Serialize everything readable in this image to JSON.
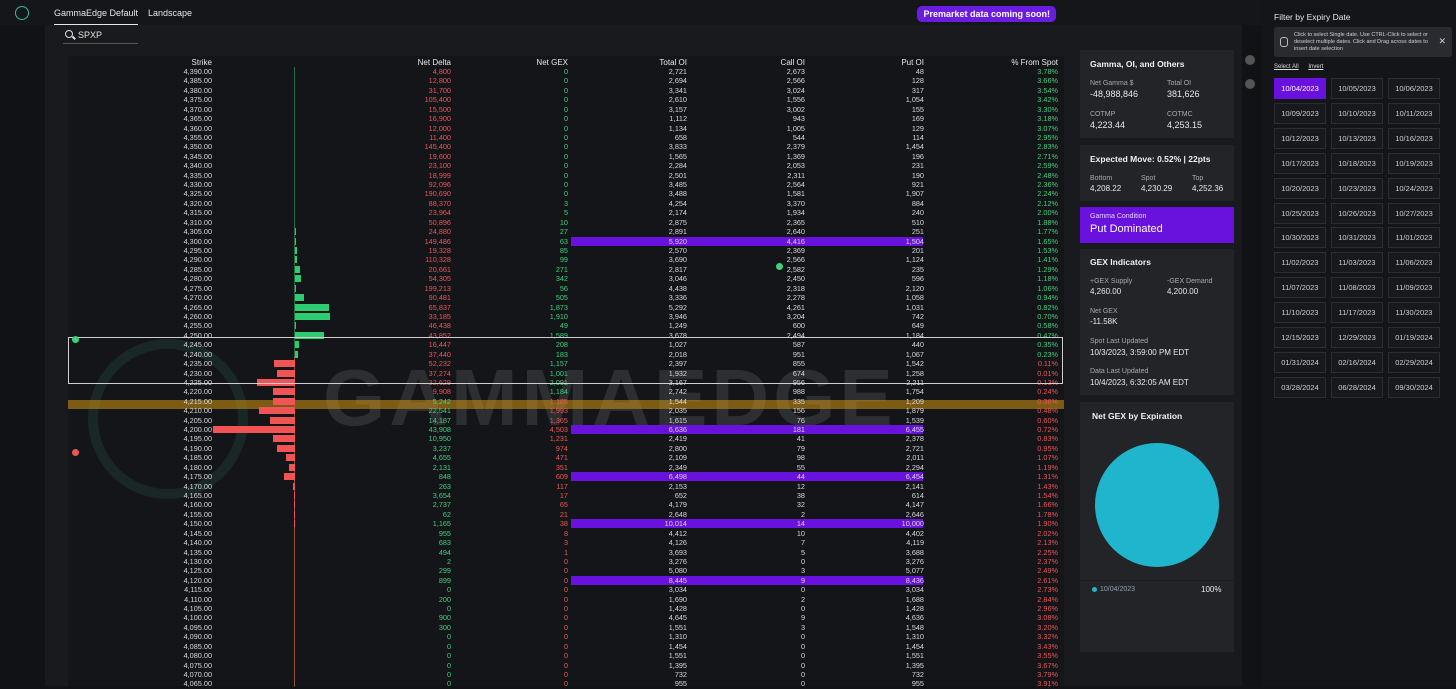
{
  "tabs": [
    "GammaEdge Default",
    "Landscape"
  ],
  "banner": "Premarket data coming soon!",
  "search": {
    "value": "SPXP"
  },
  "columns": [
    "Strike",
    "Net Delta",
    "Net GEX",
    "Total OI",
    "Call OI",
    "Put OI",
    "% From Spot"
  ],
  "rows": [
    [
      "4,390.00",
      "4,800",
      "0",
      "2,721",
      "2,673",
      "48",
      "3.78%"
    ],
    [
      "4,385.00",
      "12,800",
      "0",
      "2,694",
      "2,566",
      "128",
      "3.66%"
    ],
    [
      "4,380.00",
      "31,700",
      "0",
      "3,341",
      "3,024",
      "317",
      "3.54%"
    ],
    [
      "4,375.00",
      "105,400",
      "0",
      "2,610",
      "1,556",
      "1,054",
      "3.42%"
    ],
    [
      "4,370.00",
      "15,500",
      "0",
      "3,157",
      "3,002",
      "155",
      "3.30%"
    ],
    [
      "4,365.00",
      "16,900",
      "0",
      "1,112",
      "943",
      "169",
      "3.18%"
    ],
    [
      "4,360.00",
      "12,000",
      "0",
      "1,134",
      "1,005",
      "129",
      "3.07%"
    ],
    [
      "4,355.00",
      "11,400",
      "0",
      "658",
      "544",
      "114",
      "2.95%"
    ],
    [
      "4,350.00",
      "145,400",
      "0",
      "3,833",
      "2,379",
      "1,454",
      "2.83%"
    ],
    [
      "4,345.00",
      "19,600",
      "0",
      "1,565",
      "1,369",
      "196",
      "2.71%"
    ],
    [
      "4,340.00",
      "23,100",
      "0",
      "2,284",
      "2,053",
      "231",
      "2.59%"
    ],
    [
      "4,335.00",
      "18,999",
      "0",
      "2,501",
      "2,311",
      "190",
      "2.48%"
    ],
    [
      "4,330.00",
      "92,096",
      "0",
      "3,485",
      "2,564",
      "921",
      "2.36%"
    ],
    [
      "4,325.00",
      "190,690",
      "0",
      "3,488",
      "1,581",
      "1,907",
      "2.24%"
    ],
    [
      "4,320.00",
      "88,370",
      "3",
      "4,254",
      "3,370",
      "884",
      "2.12%"
    ],
    [
      "4,315.00",
      "23,964",
      "5",
      "2,174",
      "1,934",
      "240",
      "2.00%"
    ],
    [
      "4,310.00",
      "50,896",
      "10",
      "2,875",
      "2,365",
      "510",
      "1.88%"
    ],
    [
      "4,305.00",
      "24,880",
      "27",
      "2,891",
      "2,640",
      "251",
      "1.77%"
    ],
    [
      "4,300.00",
      "149,486",
      "63",
      "5,920",
      "4,416",
      "1,504",
      "1.65%"
    ],
    [
      "4,295.00",
      "19,328",
      "85",
      "2,570",
      "2,369",
      "201",
      "1.53%"
    ],
    [
      "4,290.00",
      "110,328",
      "99",
      "3,690",
      "2,566",
      "1,124",
      "1.41%"
    ],
    [
      "4,285.00",
      "20,661",
      "271",
      "2,817",
      "2,582",
      "235",
      "1.29%"
    ],
    [
      "4,280.00",
      "54,305",
      "342",
      "3,046",
      "2,450",
      "596",
      "1.18%"
    ],
    [
      "4,275.00",
      "199,213",
      "56",
      "4,438",
      "2,318",
      "2,120",
      "1.06%"
    ],
    [
      "4,270.00",
      "90,481",
      "505",
      "3,336",
      "2,278",
      "1,058",
      "0.94%"
    ],
    [
      "4,265.00",
      "65,837",
      "1,873",
      "5,292",
      "4,261",
      "1,031",
      "0.82%"
    ],
    [
      "4,260.00",
      "33,185",
      "1,910",
      "3,946",
      "3,204",
      "742",
      "0.70%"
    ],
    [
      "4,255.00",
      "46,438",
      "49",
      "1,249",
      "600",
      "649",
      "0.58%"
    ],
    [
      "4,250.00",
      "43,852",
      "1,589",
      "3,678",
      "2,494",
      "1,184",
      "0.47%"
    ],
    [
      "4,245.00",
      "16,447",
      "208",
      "1,027",
      "587",
      "440",
      "0.35%"
    ],
    [
      "4,240.00",
      "37,440",
      "183",
      "2,018",
      "951",
      "1,067",
      "0.23%"
    ],
    [
      "4,235.00",
      "52,232",
      "1,157",
      "2,397",
      "855",
      "1,542",
      "0.11%"
    ],
    [
      "4,230.00",
      "37,274",
      "1,001",
      "1,932",
      "674",
      "1,258",
      "0.01%"
    ],
    [
      "4,225.00",
      "32,629",
      "2,091",
      "3,167",
      "956",
      "2,211",
      "0.13%"
    ],
    [
      "4,220.00",
      "9,908",
      "1,184",
      "2,742",
      "988",
      "1,754",
      "0.24%"
    ],
    [
      "4,215.00",
      "5,242",
      "1,185",
      "1,544",
      "335",
      "1,209",
      "0.36%"
    ],
    [
      "4,210.00",
      "22,541",
      "1,993",
      "2,035",
      "156",
      "1,879",
      "0.48%"
    ],
    [
      "4,205.00",
      "14,187",
      "1,365",
      "1,615",
      "76",
      "1,539",
      "0.60%"
    ],
    [
      "4,200.00",
      "43,908",
      "4,503",
      "6,636",
      "181",
      "6,455",
      "0.72%"
    ],
    [
      "4,195.00",
      "10,950",
      "1,231",
      "2,419",
      "41",
      "2,378",
      "0.83%"
    ],
    [
      "4,190.00",
      "3,237",
      "974",
      "2,800",
      "79",
      "2,721",
      "0.95%"
    ],
    [
      "4,185.00",
      "4,655",
      "471",
      "2,109",
      "98",
      "2,011",
      "1.07%"
    ],
    [
      "4,180.00",
      "2,131",
      "351",
      "2,349",
      "55",
      "2,294",
      "1.19%"
    ],
    [
      "4,175.00",
      "848",
      "609",
      "6,498",
      "44",
      "6,454",
      "1.31%"
    ],
    [
      "4,170.00",
      "263",
      "117",
      "2,153",
      "12",
      "2,141",
      "1.43%"
    ],
    [
      "4,165.00",
      "3,654",
      "17",
      "652",
      "38",
      "614",
      "1.54%"
    ],
    [
      "4,160.00",
      "2,737",
      "65",
      "4,179",
      "32",
      "4,147",
      "1.66%"
    ],
    [
      "4,155.00",
      "62",
      "21",
      "2,648",
      "2",
      "2,646",
      "1.78%"
    ],
    [
      "4,150.00",
      "1,165",
      "38",
      "10,014",
      "14",
      "10,000",
      "1.90%"
    ],
    [
      "4,145.00",
      "955",
      "8",
      "4,412",
      "10",
      "4,402",
      "2.02%"
    ],
    [
      "4,140.00",
      "683",
      "3",
      "4,126",
      "7",
      "4,119",
      "2.13%"
    ],
    [
      "4,135.00",
      "494",
      "1",
      "3,693",
      "5",
      "3,688",
      "2.25%"
    ],
    [
      "4,130.00",
      "2",
      "0",
      "3,276",
      "0",
      "3,276",
      "2.37%"
    ],
    [
      "4,125.00",
      "299",
      "0",
      "5,080",
      "3",
      "5,077",
      "2.49%"
    ],
    [
      "4,120.00",
      "899",
      "0",
      "8,445",
      "9",
      "8,436",
      "2.61%"
    ],
    [
      "4,115.00",
      "0",
      "0",
      "3,034",
      "0",
      "3,034",
      "2.73%"
    ],
    [
      "4,110.00",
      "200",
      "0",
      "1,690",
      "2",
      "1,688",
      "2.84%"
    ],
    [
      "4,105.00",
      "0",
      "0",
      "1,428",
      "0",
      "1,428",
      "2.96%"
    ],
    [
      "4,100.00",
      "900",
      "0",
      "4,645",
      "9",
      "4,636",
      "3.08%"
    ],
    [
      "4,095.00",
      "300",
      "0",
      "1,551",
      "3",
      "1,548",
      "3.20%"
    ],
    [
      "4,090.00",
      "0",
      "0",
      "1,310",
      "0",
      "1,310",
      "3.32%"
    ],
    [
      "4,085.00",
      "0",
      "0",
      "1,454",
      "0",
      "1,454",
      "3.43%"
    ],
    [
      "4,080.00",
      "0",
      "0",
      "1,551",
      "0",
      "1,551",
      "3.55%"
    ],
    [
      "4,075.00",
      "0",
      "0",
      "1,395",
      "0",
      "1,395",
      "3.67%"
    ],
    [
      "4,070.00",
      "0",
      "0",
      "732",
      "0",
      "732",
      "3.79%"
    ],
    [
      "4,065.00",
      "0",
      "0",
      "955",
      "0",
      "955",
      "3.91%"
    ]
  ],
  "row_colors": {
    "delta_pos_start": 35,
    "gex_pos_start": 35
  },
  "highlighted_rows": [
    18,
    38,
    43,
    48,
    54
  ],
  "spot_row": 32,
  "selected_rows": [
    26,
    30
  ],
  "gex_bars": [
    {
      "row": 17,
      "gex": 27
    },
    {
      "row": 18,
      "gex": 63
    },
    {
      "row": 19,
      "gex": 85
    },
    {
      "row": 20,
      "gex": 99
    },
    {
      "row": 21,
      "gex": 271
    },
    {
      "row": 22,
      "gex": 342
    },
    {
      "row": 23,
      "gex": 56
    },
    {
      "row": 24,
      "gex": 505
    },
    {
      "row": 25,
      "gex": 1873
    },
    {
      "row": 26,
      "gex": 1910
    },
    {
      "row": 27,
      "gex": 49
    },
    {
      "row": 28,
      "gex": 1589
    },
    {
      "row": 29,
      "gex": 208
    },
    {
      "row": 30,
      "gex": 183
    },
    {
      "row": 31,
      "gex": -1157
    },
    {
      "row": 32,
      "gex": -1001
    },
    {
      "row": 33,
      "gex": -2091
    },
    {
      "row": 34,
      "gex": -1184
    },
    {
      "row": 35,
      "gex": -1185
    },
    {
      "row": 36,
      "gex": -1993
    },
    {
      "row": 37,
      "gex": -1365
    },
    {
      "row": 38,
      "gex": -4503
    },
    {
      "row": 39,
      "gex": -1231
    },
    {
      "row": 40,
      "gex": -974
    },
    {
      "row": 41,
      "gex": -471
    },
    {
      "row": 42,
      "gex": -351
    },
    {
      "row": 43,
      "gex": -609
    },
    {
      "row": 44,
      "gex": -117
    },
    {
      "row": 45,
      "gex": -17
    },
    {
      "row": 46,
      "gex": -65
    },
    {
      "row": 47,
      "gex": -21
    },
    {
      "row": 48,
      "gex": -38
    }
  ],
  "watermark": "GAMMAEDGE",
  "summary": {
    "title": "Gamma, OI, and Others",
    "net_gamma_label": "Net Gamma $",
    "net_gamma": "-48,988,846",
    "total_oi_label": "Total OI",
    "total_oi": "381,626",
    "cotmp_label": "COTMP",
    "cotmp": "4,223.44",
    "cotmc_label": "COTMC",
    "cotmc": "4,253.15"
  },
  "expected": {
    "title": "Expected Move: 0.52% | 22pts",
    "bottom_label": "Bottom",
    "bottom": "4,208.22",
    "spot_label": "Spot",
    "spot": "4,230.29",
    "top_label": "Top",
    "top": "4,252.36"
  },
  "gamma_condition": {
    "label": "Gamma Condition",
    "value": "Put Dominated"
  },
  "gex": {
    "title": "GEX Indicators",
    "supply_label": "+GEX Supply",
    "supply": "4,260.00",
    "demand_label": "-GEX Demand",
    "demand": "4,200.00",
    "net_label": "Net GEX",
    "net": "-11.58K",
    "spot_updated_label": "Spot Last Updated",
    "spot_updated": "10/3/2023, 3:59:00 PM EDT",
    "data_updated_label": "Data Last Updated",
    "data_updated": "10/4/2023, 6:32:05 AM EDT"
  },
  "pie": {
    "title": "Net GEX by Expiration",
    "legend_label": "10/04/2023",
    "legend_value": "100%",
    "color": "#1fb5cc"
  },
  "filter": {
    "title": "Filter by Expiry Date",
    "tip": "Click to select Single date. Use CTRL-Click to select or deselect multiple dates. Click and Drag across dates to insert date selection",
    "select_all": "Select All",
    "invert": "Invert",
    "dates": [
      "10/04/2023",
      "10/05/2023",
      "10/06/2023",
      "10/09/2023",
      "10/10/2023",
      "10/11/2023",
      "10/12/2023",
      "10/13/2023",
      "10/16/2023",
      "10/17/2023",
      "10/18/2023",
      "10/19/2023",
      "10/20/2023",
      "10/23/2023",
      "10/24/2023",
      "10/25/2023",
      "10/26/2023",
      "10/27/2023",
      "10/30/2023",
      "10/31/2023",
      "11/01/2023",
      "11/02/2023",
      "11/03/2023",
      "11/06/2023",
      "11/07/2023",
      "11/08/2023",
      "11/09/2023",
      "11/10/2023",
      "11/17/2023",
      "11/30/2023",
      "12/15/2023",
      "12/29/2023",
      "01/19/2024",
      "01/31/2024",
      "02/16/2024",
      "02/29/2024",
      "03/28/2024",
      "06/28/2024",
      "09/30/2024"
    ],
    "selected": 0
  },
  "colors": {
    "accent": "#6a12dd",
    "positive": "#3fd17a",
    "negative": "#ef5454",
    "spot": "#d29614"
  }
}
